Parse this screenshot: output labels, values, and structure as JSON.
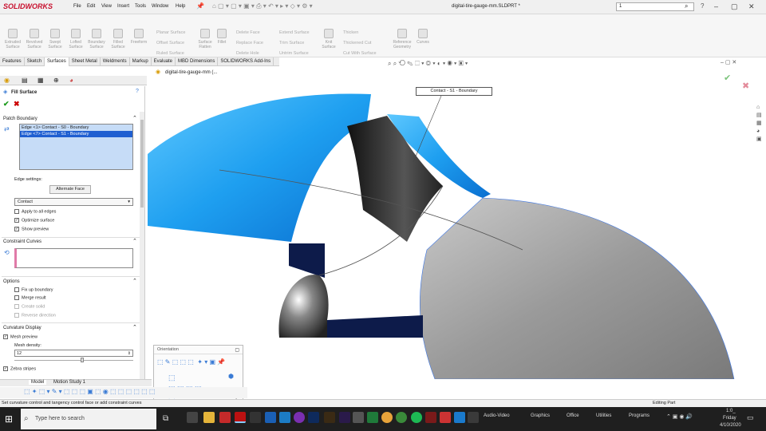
{
  "app": {
    "brand": "SOLIDWORKS",
    "document_title": "digital-tire-gauge-mm.SLDPRT *",
    "search_value": "1"
  },
  "menu": [
    "File",
    "Edit",
    "View",
    "Insert",
    "Tools",
    "Window",
    "Help"
  ],
  "ribbon": {
    "big_buttons": [
      "Extruded Surface",
      "Revolved Surface",
      "Swept Surface",
      "Lofted Surface",
      "Boundary Surface",
      "Filled Surface",
      "Freeform"
    ],
    "col1": [
      "Planar Surface",
      "Offset Surface",
      "Ruled Surface"
    ],
    "surface_flatten": "Surface Flatten",
    "fillet": "Fillet",
    "col2": [
      "Delete Face",
      "Replace Face",
      "Delete Hole"
    ],
    "col3": [
      "Extend Surface",
      "Trim Surface",
      "Untrim Surface"
    ],
    "knit": "Knit Surface",
    "col4": [
      "Thicken",
      "Thickened Cut",
      "Cut With Surface"
    ],
    "ref_geom": "Reference Geometry",
    "curves": "Curves"
  },
  "tabs": [
    "Features",
    "Sketch",
    "Surfaces",
    "Sheet Metal",
    "Weldments",
    "Markup",
    "Evaluate",
    "MBD Dimensions",
    "SOLIDWORKS Add-Ins"
  ],
  "active_tab": "Surfaces",
  "tree_label": "digital-tire-gauge-mm (...",
  "pm": {
    "title": "Fill Surface",
    "patch_boundary": "Patch Boundary",
    "edges": [
      "Edge <1> Contact - S0 - Boundary",
      "Edge <7> Contact - S1 - Boundary"
    ],
    "edge_settings": "Edge settings:",
    "alternate_face": "Alternate Face",
    "contact_select": "Contact",
    "apply_all": "Apply to all edges",
    "optimize": "Optimize surface",
    "show_preview": "Show preview",
    "constraint_curves": "Constraint Curves",
    "options": "Options",
    "fix_boundary": "Fix up boundary",
    "merge_result": "Merge result",
    "create_solid": "Create solid",
    "reverse_direction": "Reverse direction",
    "curvature_display": "Curvature Display",
    "mesh_preview": "Mesh preview",
    "mesh_density": "Mesh density:",
    "mesh_value": "12",
    "zebra": "Zebra stripes"
  },
  "callout": "Contact - S1 - Boundary",
  "orientation": {
    "title": "Orientation"
  },
  "bottom_tabs": [
    "Model",
    "Motion Study 1"
  ],
  "status": {
    "hint": "Set curvature control and tangency control face or add constraint curves",
    "mode": "Editing Part"
  },
  "taskbar": {
    "search_placeholder": "Type here to search",
    "folders": [
      "Audio-Video",
      "Graphics",
      "Office",
      "Utilities",
      "Programs"
    ],
    "time": "1:0_",
    "day": "Friday",
    "date": "4/10/2020"
  },
  "colors": {
    "surface_blue": "#1e9ff0",
    "dark_face": "#2a2a2a",
    "grey_face": "#9a9a9a",
    "navy": "#0d1b4a",
    "highlight": "#3d77e6"
  }
}
